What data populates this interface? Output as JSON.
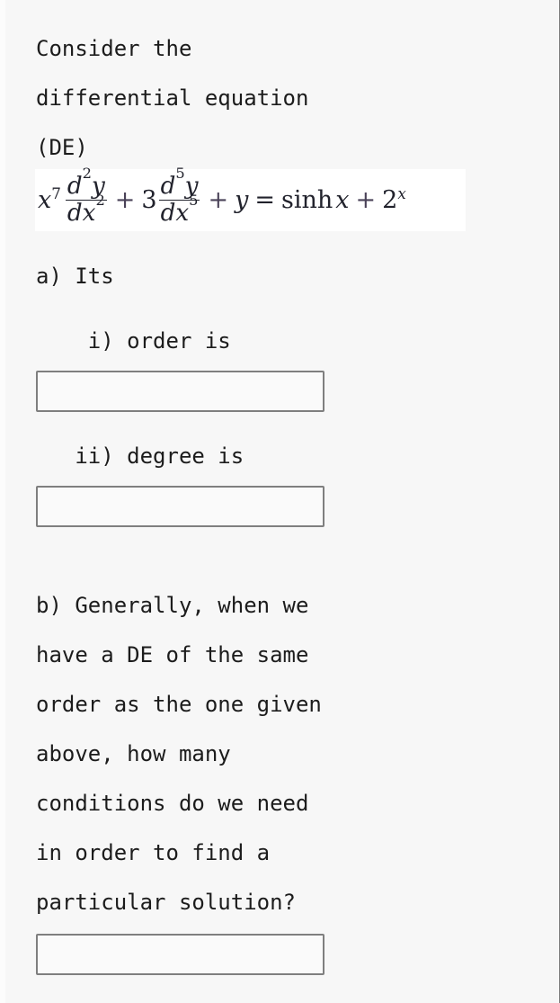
{
  "page": {
    "background_color": "#f7f7f7",
    "text_color": "#1c1c1c",
    "border_color": "#7d7d7d"
  },
  "question": {
    "stem_lines": [
      "Consider the",
      "differential equation",
      "(DE)"
    ],
    "stem_text": "Consider the\ndifferential equation\n(DE)",
    "equation": {
      "latex": "x^7 \\frac{d^2y}{dx^2} + 3\\frac{d^5y}{dx^5} + y = \\sinh x + 2^x",
      "plain": "x^7 d^2y/dx^2 + 3 d^5y/dx^5 + y = sinh x + 2^x",
      "background_color": "#ffffff",
      "terms": {
        "coefficient_1": "x",
        "coefficient_1_power": "7",
        "derivative_1_order": "2",
        "coefficient_2": "3",
        "derivative_2_order": "5",
        "linear_term": "y",
        "rhs_1": "sinh",
        "rhs_1_arg": "x",
        "rhs_2_base": "2",
        "rhs_2_exponent": "x"
      },
      "symbols": {
        "plus": "+",
        "equals": "=",
        "d": "d",
        "y": "y",
        "x": "x"
      }
    }
  },
  "part_a": {
    "label": "a) Its",
    "sub_i": {
      "label": "    i) order is",
      "input_value": "",
      "input_placeholder": ""
    },
    "sub_ii": {
      "label": "   ii) degree is",
      "input_value": "",
      "input_placeholder": ""
    }
  },
  "part_b": {
    "lines": [
      "b) Generally, when we",
      "have a DE of the same",
      "order as the one given",
      "above, how many",
      "conditions do we need",
      "in order to find a",
      "particular solution?"
    ],
    "text": "b) Generally, when we\nhave a DE of the same\norder as the one given\nabove, how many\nconditions do we need\nin order to find a\nparticular solution?",
    "input_value": "",
    "input_placeholder": ""
  }
}
